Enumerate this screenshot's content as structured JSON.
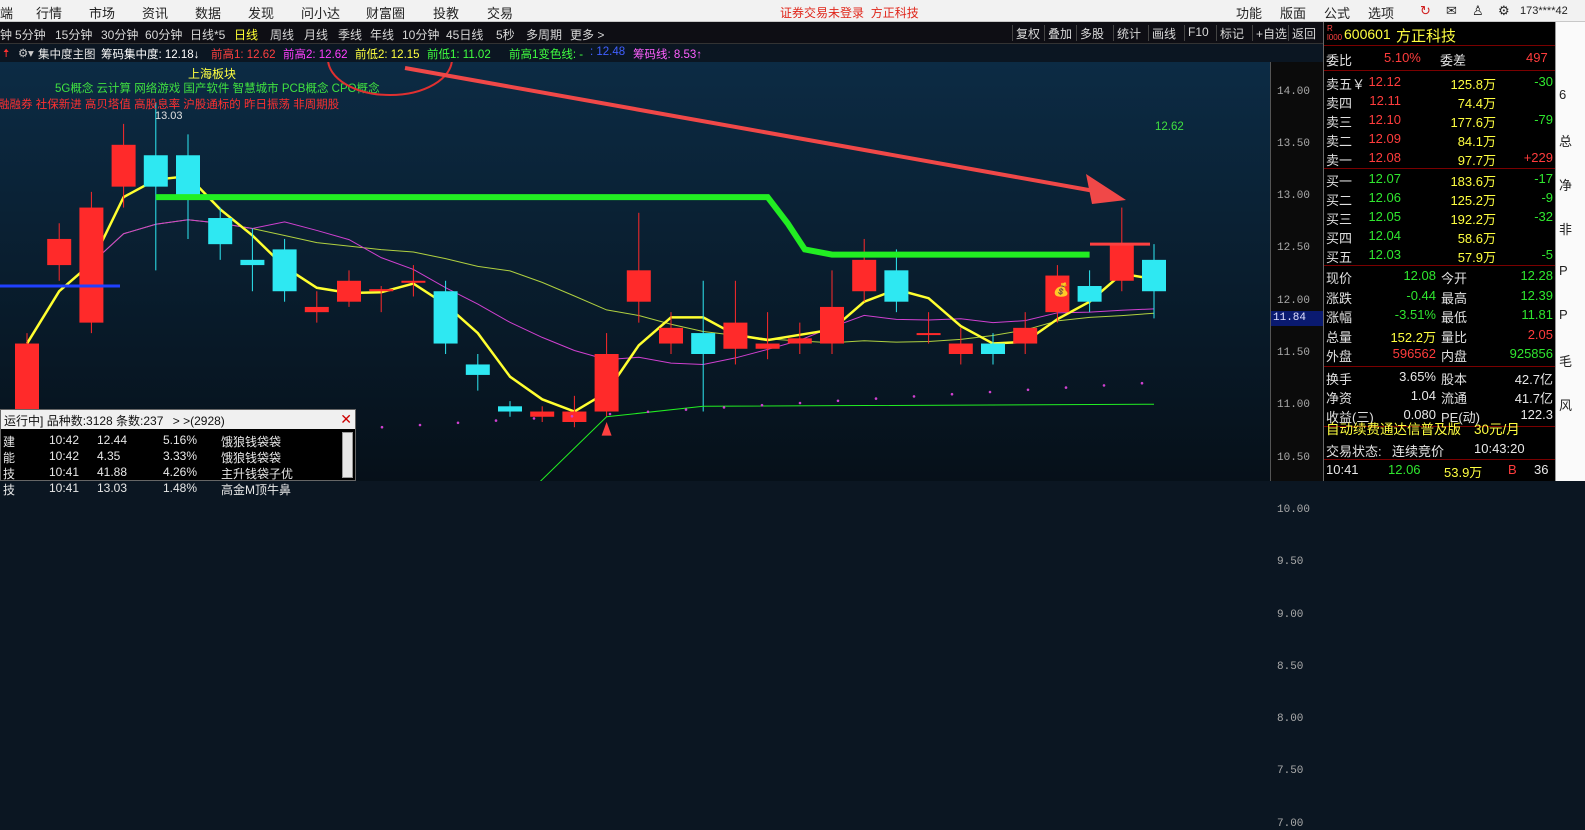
{
  "menubar": {
    "items": [
      "端",
      "行情",
      "市场",
      "资讯",
      "数据",
      "发现",
      "问小达",
      "财富圈",
      "投教",
      "交易"
    ],
    "status_notice": "证券交易未登录",
    "broker": "方正科技",
    "right_items": [
      "功能",
      "版面",
      "公式",
      "选项"
    ],
    "account": "173****42"
  },
  "period_bar": {
    "tabs": [
      "钟",
      "5分钟",
      "15分钟",
      "30分钟",
      "60分钟",
      "日线*5",
      "日线",
      "周线",
      "月线",
      "季线",
      "年线",
      "10分钟",
      "45日线",
      "5秒",
      "多周期",
      "更多 >"
    ],
    "active_tab": "日线",
    "tools": [
      "复权",
      "叠加",
      "多股",
      "统计",
      "画线",
      "F10",
      "标记",
      "+自选",
      "返回"
    ]
  },
  "indicator_bar": {
    "main_label": "集中度主图",
    "items": [
      {
        "text": "筹码集中度: 12.18↓",
        "color": "#ffffff"
      },
      {
        "text": "前高1: 12.62",
        "color": "#ff4040"
      },
      {
        "text": "前高2: 12.62",
        "color": "#ff40ff"
      },
      {
        "text": "前低2: 12.15",
        "color": "#ffff40"
      },
      {
        "text": "前低1: 11.02",
        "color": "#40ff40"
      },
      {
        "text": "前高1变色线: -",
        "color": "#40ff40"
      },
      {
        "text": ": 12.48",
        "color": "#4060ff"
      },
      {
        "text": "筹码线: 8.53↑",
        "color": "#ff60ff"
      }
    ]
  },
  "chart": {
    "sector_title": "上海板块",
    "concepts_line1": "5G概念 云计算 网络游戏 国产软件 智慧城市 PCB概念 CPO概念",
    "concepts_line2": "融融券 社保新进 高贝塔值 高股息率 沪股通标的 昨日振荡 非周期股",
    "annotations": {
      "high_marker": "13.03",
      "right_label": "12.62"
    },
    "colors": {
      "up": "#ff2a2a",
      "down": "#2ee8f2",
      "ma_yellow": "#ffff30",
      "ma_magenta": "#d040d0",
      "resistance": "#22ee22",
      "support": "#b0d040",
      "arrow": "#ff4040"
    }
  },
  "chart_data": {
    "type": "candlestick",
    "ylim": [
      6.9,
      14.5
    ],
    "y_ticks": [
      "14.00",
      "13.50",
      "13.00",
      "12.50",
      "12.00",
      "11.50",
      "11.00",
      "10.50",
      "10.00",
      "9.50",
      "9.00",
      "8.50",
      "8.00",
      "7.50",
      "7.00"
    ],
    "current_price": "11.84",
    "candles": [
      {
        "o": 10.9,
        "c": 11.6,
        "h": 11.7,
        "l": 10.8
      },
      {
        "o": 12.35,
        "c": 12.6,
        "h": 12.75,
        "l": 12.2
      },
      {
        "o": 11.8,
        "c": 12.9,
        "h": 13.05,
        "l": 11.7
      },
      {
        "o": 13.1,
        "c": 13.5,
        "h": 13.7,
        "l": 12.9
      },
      {
        "o": 13.4,
        "c": 13.1,
        "h": 13.9,
        "l": 12.3
      },
      {
        "o": 13.4,
        "c": 13.0,
        "h": 13.6,
        "l": 12.6
      },
      {
        "o": 12.8,
        "c": 12.55,
        "h": 12.9,
        "l": 12.4
      },
      {
        "o": 12.4,
        "c": 12.35,
        "h": 12.7,
        "l": 12.1
      },
      {
        "o": 12.5,
        "c": 12.1,
        "h": 12.6,
        "l": 12.0
      },
      {
        "o": 11.9,
        "c": 11.95,
        "h": 12.1,
        "l": 11.8
      },
      {
        "o": 12.0,
        "c": 12.2,
        "h": 12.3,
        "l": 11.95
      },
      {
        "o": 12.1,
        "c": 12.12,
        "h": 12.15,
        "l": 11.9
      },
      {
        "o": 12.2,
        "c": 12.2,
        "h": 12.35,
        "l": 12.05
      },
      {
        "o": 12.1,
        "c": 11.6,
        "h": 12.2,
        "l": 11.5
      },
      {
        "o": 11.4,
        "c": 11.3,
        "h": 11.5,
        "l": 11.15
      },
      {
        "o": 11.0,
        "c": 10.95,
        "h": 11.05,
        "l": 10.9
      },
      {
        "o": 10.9,
        "c": 10.95,
        "h": 11.0,
        "l": 10.85
      },
      {
        "o": 10.85,
        "c": 10.95,
        "h": 11.1,
        "l": 10.8
      },
      {
        "o": 10.95,
        "c": 11.5,
        "h": 11.7,
        "l": 10.9
      },
      {
        "o": 12.0,
        "c": 12.3,
        "h": 12.85,
        "l": 11.8
      },
      {
        "o": 11.6,
        "c": 11.75,
        "h": 11.9,
        "l": 11.5
      },
      {
        "o": 11.7,
        "c": 11.5,
        "h": 12.2,
        "l": 10.95
      },
      {
        "o": 11.55,
        "c": 11.8,
        "h": 12.2,
        "l": 11.4
      },
      {
        "o": 11.55,
        "c": 11.6,
        "h": 11.9,
        "l": 11.45
      },
      {
        "o": 11.6,
        "c": 11.65,
        "h": 11.8,
        "l": 11.5
      },
      {
        "o": 11.6,
        "c": 11.95,
        "h": 12.3,
        "l": 11.5
      },
      {
        "o": 12.1,
        "c": 12.4,
        "h": 12.6,
        "l": 12.0
      },
      {
        "o": 12.3,
        "c": 12.0,
        "h": 12.5,
        "l": 11.9
      },
      {
        "o": 11.7,
        "c": 11.7,
        "h": 11.9,
        "l": 11.6
      },
      {
        "o": 11.5,
        "c": 11.6,
        "h": 11.75,
        "l": 11.4
      },
      {
        "o": 11.6,
        "c": 11.5,
        "h": 11.7,
        "l": 11.4
      },
      {
        "o": 11.6,
        "c": 11.75,
        "h": 11.9,
        "l": 11.5
      },
      {
        "o": 11.9,
        "c": 12.25,
        "h": 12.35,
        "l": 11.8
      },
      {
        "o": 12.15,
        "c": 12.0,
        "h": 12.3,
        "l": 11.9
      },
      {
        "o": 12.2,
        "c": 12.55,
        "h": 12.9,
        "l": 12.1
      },
      {
        "o": 12.4,
        "c": 12.1,
        "h": 12.55,
        "l": 11.84
      }
    ]
  },
  "scroll_panel": {
    "status": "运行中]",
    "count_label": "品种数:3128 条数:237",
    "more": "> >(2928)",
    "rows": [
      {
        "name": "建",
        "time": "10:42",
        "price": "12.44",
        "pct": "5.16%",
        "signal": "饿狼钱袋袋"
      },
      {
        "name": "能",
        "time": "10:42",
        "price": "4.35",
        "pct": "3.33%",
        "signal": "饿狼钱袋袋"
      },
      {
        "name": "技",
        "time": "10:41",
        "price": "41.88",
        "pct": "4.26%",
        "signal": "主升钱袋子优"
      },
      {
        "name": "技",
        "time": "10:41",
        "price": "13.03",
        "pct": "1.48%",
        "signal": "高金M顶牛鼻"
      }
    ]
  },
  "quote": {
    "code": "600601",
    "name": "方正科技",
    "wei_bi_label": "委比",
    "wei_bi": "5.10%",
    "wei_cha_label": "委差",
    "wei_cha": "497",
    "asks": [
      {
        "label": "卖五￥",
        "price": "12.12",
        "vol": "125.8万",
        "chg": "-30"
      },
      {
        "label": "卖四",
        "price": "12.11",
        "vol": "74.4万",
        "chg": ""
      },
      {
        "label": "卖三",
        "price": "12.10",
        "vol": "177.6万",
        "chg": "-79"
      },
      {
        "label": "卖二",
        "price": "12.09",
        "vol": "84.1万",
        "chg": ""
      },
      {
        "label": "卖一",
        "price": "12.08",
        "vol": "97.7万",
        "chg": "+229"
      }
    ],
    "bids": [
      {
        "label": "买一",
        "price": "12.07",
        "vol": "183.6万",
        "chg": "-17"
      },
      {
        "label": "买二",
        "price": "12.06",
        "vol": "125.2万",
        "chg": "-9"
      },
      {
        "label": "买三",
        "price": "12.05",
        "vol": "192.2万",
        "chg": "-32"
      },
      {
        "label": "买四",
        "price": "12.04",
        "vol": "58.6万",
        "chg": ""
      },
      {
        "label": "买五",
        "price": "12.03",
        "vol": "57.9万",
        "chg": "-5"
      }
    ],
    "stats": [
      {
        "l1": "现价",
        "v1": "12.08",
        "c1": "grn",
        "l2": "今开",
        "v2": "12.28",
        "c2": "grn"
      },
      {
        "l1": "涨跌",
        "v1": "-0.44",
        "c1": "grn",
        "l2": "最高",
        "v2": "12.39",
        "c2": "grn"
      },
      {
        "l1": "涨幅",
        "v1": "-3.51%",
        "c1": "grn",
        "l2": "最低",
        "v2": "11.81",
        "c2": "grn"
      },
      {
        "l1": "总量",
        "v1": "152.2万",
        "c1": "yel",
        "l2": "量比",
        "v2": "2.05",
        "c2": "red"
      },
      {
        "l1": "外盘",
        "v1": "596562",
        "c1": "red",
        "l2": "内盘",
        "v2": "925856",
        "c2": "grn"
      }
    ],
    "fundamentals": [
      {
        "l1": "换手",
        "v1": "3.65%",
        "l2": "股本",
        "v2": "42.7亿"
      },
      {
        "l1": "净资",
        "v1": "1.04",
        "l2": "流通",
        "v2": "41.7亿"
      },
      {
        "l1": "收益(三)",
        "v1": "0.080",
        "l2": "PE(动)",
        "v2": "122.3"
      }
    ],
    "promo": "自动续费通达信普及版",
    "promo_price": "30元/月",
    "trade_status_label": "交易状态:",
    "trade_status": "连续竞价",
    "trade_time": "10:43:20",
    "last_tick": {
      "time": "10:41",
      "price": "12.06",
      "vol": "53.9万",
      "side": "B",
      "count": "36"
    }
  },
  "edge_chars": [
    "6",
    "总",
    "净",
    "非",
    "P",
    "P",
    "毛",
    "风"
  ]
}
